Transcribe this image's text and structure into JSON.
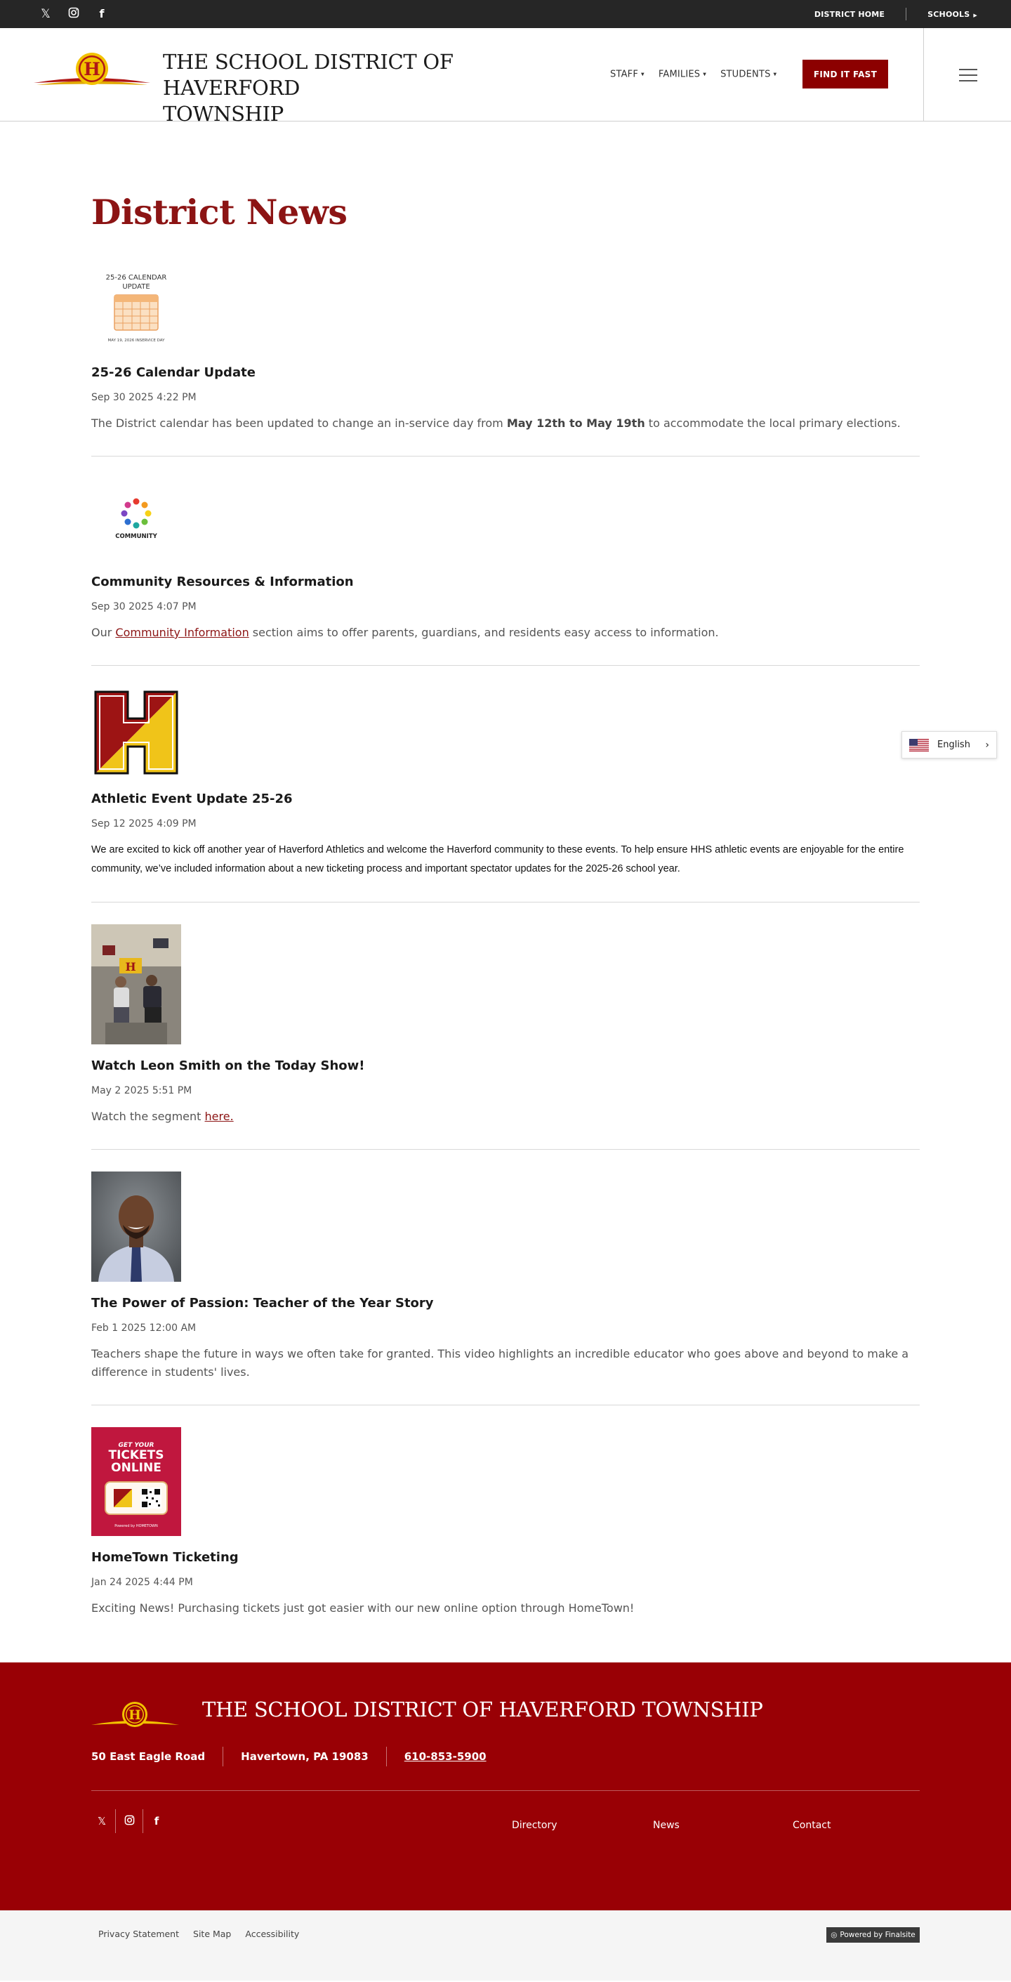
{
  "topbar": {
    "social_icons": [
      "x-twitter-icon",
      "instagram-icon",
      "facebook-icon"
    ],
    "district_home": "DISTRICT HOME",
    "schools": "SCHOOLS"
  },
  "header": {
    "school_name_line1": "THE SCHOOL DISTRICT OF HAVERFORD",
    "school_name_line2": "TOWNSHIP",
    "nav": [
      {
        "label": "STAFF"
      },
      {
        "label": "FAMILIES"
      },
      {
        "label": "STUDENTS"
      }
    ],
    "find_it_fast": "FIND IT FAST"
  },
  "main": {
    "page_title": "District News",
    "news": [
      {
        "thumb": {
          "line1": "25-26 CALENDAR",
          "line2": "UPDATE",
          "caption": "MAY 19, 2026 INSERVICE DAY"
        },
        "title": "25-26 Calendar Update",
        "date": "Sep 30 2025 4:22 PM",
        "summary_pre": "The District calendar has been updated to change an in-service day from ",
        "summary_bold": "May 12th to May 19th",
        "summary_post": " to accommodate the local primary elections."
      },
      {
        "thumb": {
          "label": "COMMUNITY"
        },
        "title": "Community Resources & Information",
        "date": "Sep 30 2025 4:07 PM",
        "summary_pre": "Our ",
        "summary_link": "Community Information",
        "summary_post": " section aims to offer parents, guardians, and residents easy access to information."
      },
      {
        "thumb": {
          "letter": "H"
        },
        "title": "Athletic Event Update 25-26",
        "date": "Sep 12 2025 4:09 PM",
        "summary": "We are excited to kick off another year of Haverford Athletics and welcome the Haverford community to these events. To help ensure HHS athletic events are enjoyable for the entire community, we’ve included information about a new ticketing process and important spectator updates for the 2025-26 school year."
      },
      {
        "title": "Watch Leon Smith on the Today Show!",
        "date": "May 2 2025 5:51 PM",
        "summary_pre": "Watch the segment ",
        "summary_link": "here."
      },
      {
        "title": "The Power of Passion: Teacher of the Year Story",
        "date": "Feb 1 2025 12:00 AM",
        "summary": "Teachers shape the future in ways we often take for granted. This video highlights an incredible educator who goes above and beyond to make a difference in students' lives."
      },
      {
        "thumb": {
          "line1": "GET YOUR",
          "line2": "TICKETS",
          "line3": "ONLINE",
          "powered": "Powered by  HOMETOWN"
        },
        "title": "HomeTown Ticketing",
        "date": "Jan 24 2025 4:44 PM",
        "summary": "Exciting News! Purchasing tickets just got easier with our new online option through HomeTown!"
      }
    ]
  },
  "language": {
    "label": "English",
    "icon": "us-flag-icon"
  },
  "footer": {
    "name": "THE SCHOOL DISTRICT OF HAVERFORD TOWNSHIP",
    "address": "50 East Eagle Road",
    "city": "Havertown, PA  19083",
    "phone": "610-853-5900",
    "links": {
      "directory": "Directory",
      "news": "News",
      "contact": "Contact"
    }
  },
  "bottom": {
    "links": [
      "Privacy Statement",
      "Site Map",
      "Accessibility"
    ],
    "powered": "Powered by Finalsite"
  },
  "colors": {
    "brand": "#8c1414",
    "footer_bg": "#990005",
    "topbar_bg": "#262626",
    "gold": "#f2c200"
  }
}
